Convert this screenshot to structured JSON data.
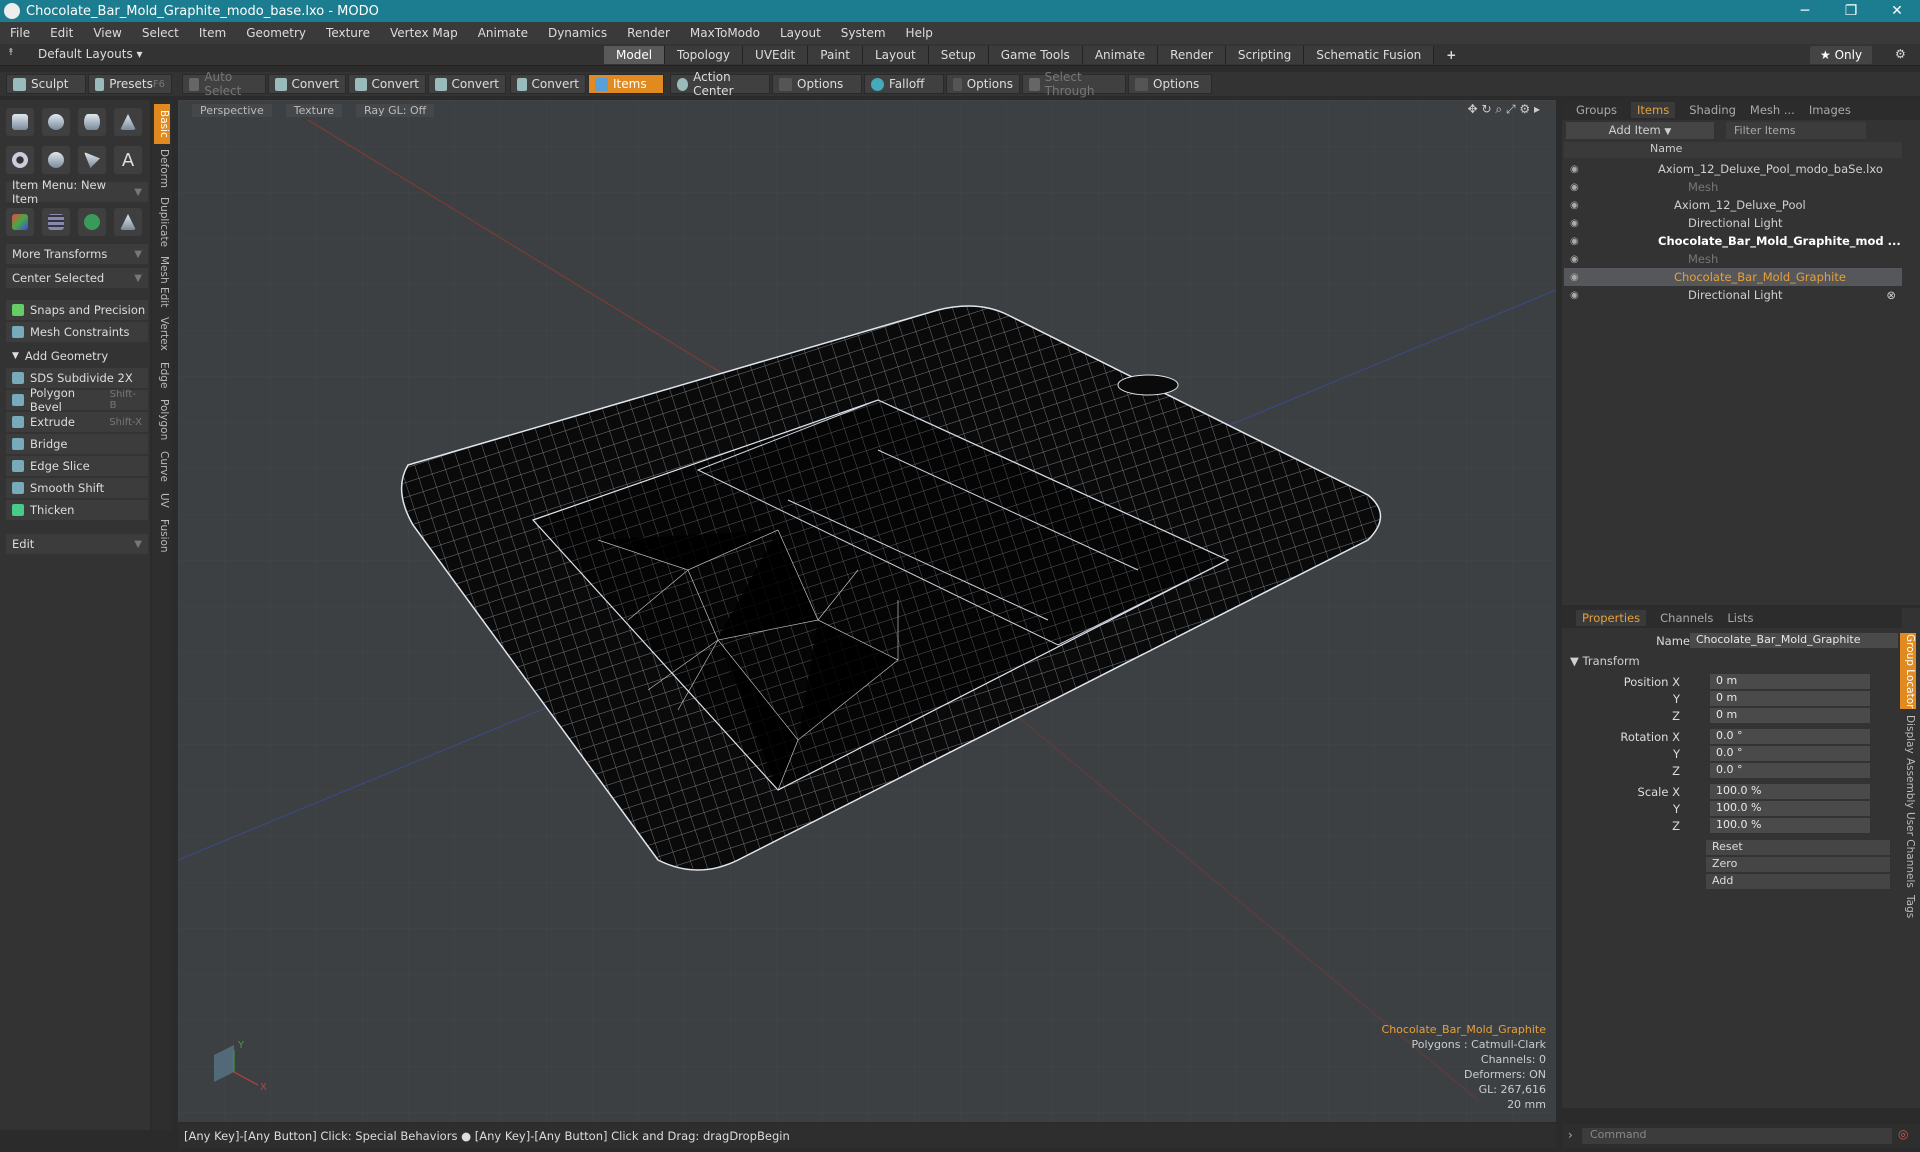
{
  "window": {
    "title": "Chocolate_Bar_Mold_Graphite_modo_base.lxo - MODO"
  },
  "menu": [
    "File",
    "Edit",
    "View",
    "Select",
    "Item",
    "Geometry",
    "Texture",
    "Vertex Map",
    "Animate",
    "Dynamics",
    "Render",
    "MaxToModo",
    "Layout",
    "System",
    "Help"
  ],
  "layouts": {
    "label": "Default Layouts ▾"
  },
  "tabs": [
    "Model",
    "Topology",
    "UVEdit",
    "Paint",
    "Layout",
    "Setup",
    "Game Tools",
    "Animate",
    "Render",
    "Scripting",
    "Schematic Fusion"
  ],
  "only_label": "★ Only",
  "toolbar": {
    "sculpt": "Sculpt",
    "presets": "Presets",
    "presets_key": "F6",
    "auto_select": "Auto Select",
    "convert": "Convert",
    "items": "Items",
    "action_center": "Action Center",
    "options": "Options",
    "falloff": "Falloff",
    "select_through": "Select Through"
  },
  "left": {
    "item_menu": "Item Menu: New Item",
    "more_transforms": "More Transforms",
    "center_selected": "Center Selected",
    "snaps": "Snaps and Precision",
    "mesh_constraints": "Mesh Constraints",
    "add_geometry": "Add Geometry",
    "tools": [
      {
        "label": "SDS Subdivide 2X",
        "key": ""
      },
      {
        "label": "Polygon Bevel",
        "key": "Shift-B"
      },
      {
        "label": "Extrude",
        "key": "Shift-X"
      },
      {
        "label": "Bridge",
        "key": ""
      },
      {
        "label": "Edge Slice",
        "key": ""
      },
      {
        "label": "Smooth Shift",
        "key": ""
      },
      {
        "label": "Thicken",
        "key": ""
      }
    ],
    "edit": "Edit"
  },
  "sidetabs": [
    "Basic",
    "Deform",
    "Duplicate",
    "Mesh Edit",
    "Vertex",
    "Edge",
    "Polygon",
    "Curve",
    "UV",
    "Fusion"
  ],
  "viewport": {
    "perspective": "Perspective",
    "texture": "Texture",
    "raygl": "Ray GL: Off",
    "info": {
      "name": "Chocolate_Bar_Mold_Graphite",
      "polygons": "Polygons : Catmull-Clark",
      "channels": "Channels: 0",
      "deformers": "Deformers: ON",
      "gl": "GL: 267,616",
      "unit": "20 mm"
    }
  },
  "status": "[Any Key]-[Any Button] Click: Special Behaviors ● [Any Key]-[Any Button] Click and Drag: dragDropBegin",
  "items_panel": {
    "tabs": [
      "Groups",
      "Items",
      "Shading",
      "Mesh ...",
      "Images"
    ],
    "add_item": "Add Item",
    "filter": "Filter Items",
    "name_col": "Name",
    "tree": [
      {
        "label": "Axiom_12_Deluxe_Pool_modo_baSe.lxo",
        "indent": 0,
        "bold": false,
        "dim": false,
        "sel": false
      },
      {
        "label": "Mesh",
        "indent": 2,
        "bold": false,
        "dim": true,
        "sel": false
      },
      {
        "label": "Axiom_12_Deluxe_Pool",
        "indent": 1,
        "bold": false,
        "dim": false,
        "sel": false
      },
      {
        "label": "Directional Light",
        "indent": 2,
        "bold": false,
        "dim": false,
        "sel": false
      },
      {
        "label": "Chocolate_Bar_Mold_Graphite_mod ...",
        "indent": 0,
        "bold": true,
        "dim": false,
        "sel": false
      },
      {
        "label": "Mesh",
        "indent": 2,
        "bold": false,
        "dim": true,
        "sel": false
      },
      {
        "label": "Chocolate_Bar_Mold_Graphite",
        "indent": 1,
        "bold": false,
        "dim": false,
        "sel": true
      },
      {
        "label": "Directional Light",
        "indent": 2,
        "bold": false,
        "dim": false,
        "sel": false
      }
    ]
  },
  "properties": {
    "tabs": [
      "Properties",
      "Channels",
      "Lists"
    ],
    "name_label": "Name",
    "name_value": "Chocolate_Bar_Mold_Graphite",
    "transform": "Transform",
    "rows": [
      {
        "label": "Position X",
        "value": "0 m"
      },
      {
        "label": "Y",
        "value": "0 m"
      },
      {
        "label": "Z",
        "value": "0 m"
      },
      {
        "label": "Rotation X",
        "value": "0.0 °"
      },
      {
        "label": "Y",
        "value": "0.0 °"
      },
      {
        "label": "Z",
        "value": "0.0 °"
      },
      {
        "label": "Scale X",
        "value": "100.0 %"
      },
      {
        "label": "Y",
        "value": "100.0 %"
      },
      {
        "label": "Z",
        "value": "100.0 %"
      }
    ],
    "reset": "Reset",
    "zero": "Zero",
    "add": "Add",
    "sidetabs": [
      "Group Locator",
      "Display",
      "Assembly",
      "User Channels",
      "Tags"
    ]
  },
  "command": "Command"
}
